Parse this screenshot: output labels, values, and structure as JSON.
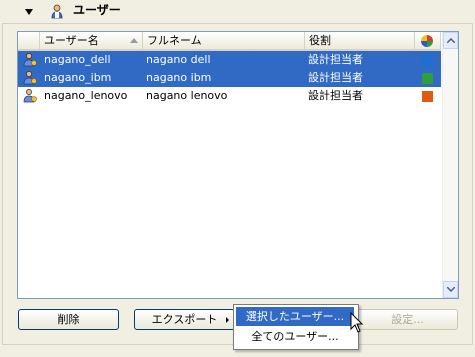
{
  "panel": {
    "title": "ユーザー"
  },
  "table": {
    "columns": [
      "ユーザー名",
      "フルネーム",
      "役割"
    ],
    "rows": [
      {
        "username": "nagano_dell",
        "fullname": "nagano dell",
        "role": "設計担当者",
        "color": "#1f6fd0",
        "selected": true
      },
      {
        "username": "nagano_ibm",
        "fullname": "nagano ibm",
        "role": "設計担当者",
        "color": "#2e9e3a",
        "selected": true
      },
      {
        "username": "nagano_lenovo",
        "fullname": "nagano lenovo",
        "role": "設計担当者",
        "color": "#e05a12",
        "selected": false
      }
    ]
  },
  "buttons": {
    "delete": "削除",
    "export": "エクスポート",
    "settings": "設定..."
  },
  "export_menu": {
    "items": [
      "選択したユーザー...",
      "全てのユーザー..."
    ]
  }
}
